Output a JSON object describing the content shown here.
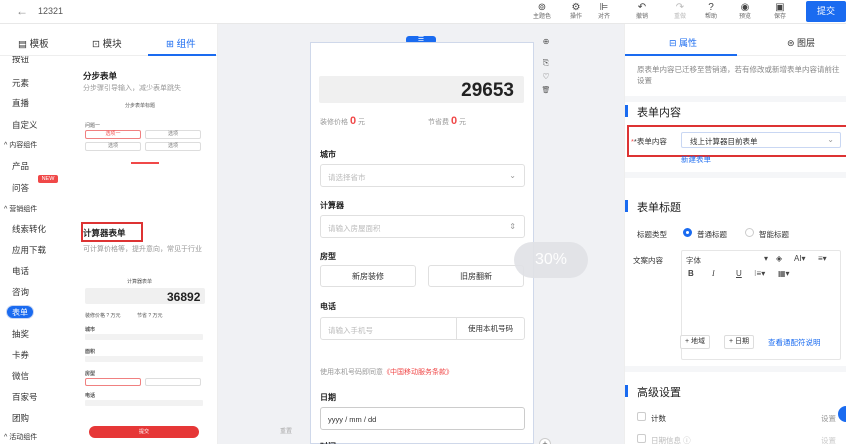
{
  "topbar": {
    "back_icon": "arrow-left-icon",
    "title": "12321",
    "tools": [
      {
        "label": "主题色",
        "icon": "theme-icon",
        "glyph": "⊚"
      },
      {
        "label": "操作",
        "icon": "gear-icon",
        "glyph": "⚙"
      },
      {
        "label": "对齐",
        "icon": "align-icon",
        "glyph": "⊫"
      },
      {
        "label": "撤销",
        "icon": "undo-icon",
        "glyph": "↶"
      },
      {
        "label": "重做",
        "icon": "redo-icon",
        "glyph": "↷"
      },
      {
        "label": "帮助",
        "icon": "help-icon",
        "glyph": "?"
      },
      {
        "label": "预览",
        "icon": "eye-icon",
        "glyph": "◉"
      },
      {
        "label": "保存",
        "icon": "save-icon",
        "glyph": "▣"
      }
    ],
    "submit_label": "提交",
    "accent": "#1a6bf0"
  },
  "left": {
    "tabs": [
      {
        "label": "▤ 模板"
      },
      {
        "label": "⊡ 模块"
      },
      {
        "label": "⊞ 组件"
      }
    ],
    "categories": [
      {
        "label": "按钮",
        "kind": "item"
      },
      {
        "label": "元素",
        "kind": "item"
      },
      {
        "label": "直播",
        "kind": "item"
      },
      {
        "label": "自定义",
        "kind": "item"
      },
      {
        "label": "^ 内容组件",
        "kind": "group"
      },
      {
        "label": "产品",
        "kind": "item"
      },
      {
        "label": "问答",
        "kind": "item",
        "badge": "NEW"
      },
      {
        "label": "^ 营销组件",
        "kind": "group"
      },
      {
        "label": "线索转化",
        "kind": "item"
      },
      {
        "label": "应用下载",
        "kind": "item"
      },
      {
        "label": "电话",
        "kind": "item"
      },
      {
        "label": "咨询",
        "kind": "item"
      },
      {
        "label": "表单",
        "kind": "selected"
      },
      {
        "label": "抽奖",
        "kind": "item"
      },
      {
        "label": "卡券",
        "kind": "item"
      },
      {
        "label": "微信",
        "kind": "item"
      },
      {
        "label": "百家号",
        "kind": "item"
      },
      {
        "label": "团购",
        "kind": "item"
      },
      {
        "label": "^ 活动组件",
        "kind": "group"
      }
    ],
    "card1": {
      "title": "分步表单",
      "desc": "分步骤引导输入，减少表单跳失",
      "preview_title": "分步表单标题",
      "step_label": "问题一",
      "btn_a": "选项一",
      "btn_b": "选项",
      "btn_c": "选项",
      "btn_d": "选项"
    },
    "card2": {
      "title": "计算器表单",
      "desc": "可计算价格等，提升意向，常见于行业",
      "preview_title": "计算器表单",
      "number": "36892",
      "price_a": "装修价格 ? 万元",
      "price_b": "节省 ? 万元",
      "fields": [
        "城市",
        "面积",
        "房型",
        "电话"
      ],
      "submit": "提交"
    }
  },
  "canvas": {
    "handle": "☰",
    "number": "29653",
    "price1_label": "装修价格",
    "price1_value": "0",
    "price1_unit": "元",
    "price2_label": "节省费",
    "price2_value": "0",
    "price2_unit": "元",
    "city_label": "城市",
    "city_placeholder": "请选择省市",
    "calc_label": "计算器",
    "calc_placeholder": "请输入房屋面积",
    "house_label": "房型",
    "house_opt1": "新房装修",
    "house_opt2": "旧房翻新",
    "phone_label": "电话",
    "phone_placeholder": "请输入手机号",
    "phone_button": "使用本机号码",
    "note_prefix": "使用本机号码即同意",
    "note_link": "《中国移动服务条款》",
    "date_label": "日期",
    "date_value": "yyyy / mm / dd",
    "time_label": "时间",
    "progress_badge": "30%",
    "reset_label": "重置",
    "tools": [
      "⊕",
      "⎘",
      "♡",
      "🗑"
    ]
  },
  "right": {
    "tabs": [
      {
        "label": "⊟ 属性"
      },
      {
        "label": "⊜ 图层"
      }
    ],
    "hint_text": "原表单内容已迁移至营销通，若有修改或新增表单内容请前往设置",
    "hint_link": "营销通",
    "sec_content": "表单内容",
    "form_label": "*表单内容",
    "form_value": "线上计算器目前表单",
    "new_form_link": "新建表单",
    "sec_title": "表单标题",
    "title_type_label": "标题类型",
    "radio_normal": "普通标题",
    "radio_smart": "智能标题",
    "text_content_label": "文案内容",
    "font_select": "字体",
    "btn_add_region": "+ 地域",
    "btn_add_date": "+ 日期",
    "btn_link": "查看通配符说明",
    "sec_adv": "高级设置",
    "adv_item1": "计数",
    "adv_item2": "日期信息 ⓘ",
    "adv_right": "设置"
  }
}
